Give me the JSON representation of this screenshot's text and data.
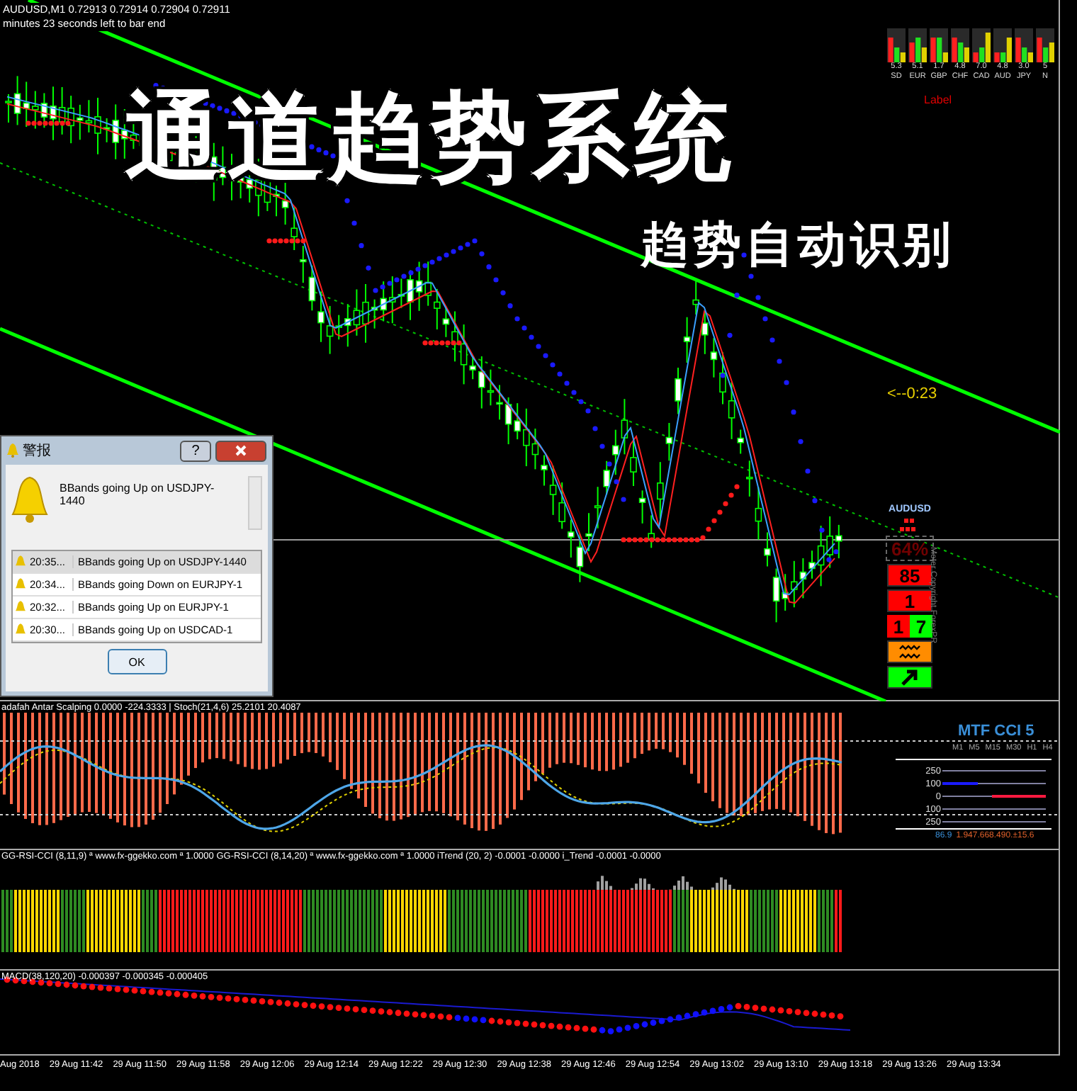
{
  "chart": {
    "symbol_line": "AUDUSD,M1  0.72913 0.72914 0.72904 0.72911",
    "timer_line": "minutes 23 seconds left to bar end",
    "title": "通道趋势系统",
    "subtitle": "趋势自动识别",
    "countdown": "<--0:23"
  },
  "strength_meter": {
    "label": "Label",
    "currencies": [
      {
        "value": "5.3",
        "code": "SD"
      },
      {
        "value": "5.1",
        "code": "EUR"
      },
      {
        "value": "1.7",
        "code": "GBP"
      },
      {
        "value": "4.8",
        "code": "CHF"
      },
      {
        "value": "7.0",
        "code": "CAD"
      },
      {
        "value": "4.8",
        "code": "AUD"
      },
      {
        "value": "3.0",
        "code": "JPY"
      },
      {
        "value": "5",
        "code": "N"
      }
    ]
  },
  "signal_panel": {
    "symbol": "AUDUSD",
    "percent": "64%",
    "copyright": "Meter Copyright ForexPR",
    "cells": [
      {
        "kind": "text",
        "text": "85",
        "color": "#ff0000"
      },
      {
        "kind": "text",
        "text": "1",
        "color": "#ff0000"
      },
      {
        "kind": "pair",
        "parts": [
          {
            "text": "1",
            "color": "#ff0000"
          },
          {
            "text": "7",
            "color": "#00ff00"
          }
        ]
      },
      {
        "kind": "wave",
        "color": "#ff8c00"
      },
      {
        "kind": "arrow",
        "color": "#00ff00"
      }
    ]
  },
  "alert_dialog": {
    "title": "警报",
    "help": "?",
    "message": "BBands going Up on USDJPY-1440",
    "ok": "OK",
    "rows": [
      {
        "time": "20:35...",
        "text": "BBands going Up on USDJPY-1440",
        "selected": true
      },
      {
        "time": "20:34...",
        "text": "BBands going Down on EURJPY-1",
        "selected": false
      },
      {
        "time": "20:32...",
        "text": "BBands going Up on EURJPY-1",
        "selected": false
      },
      {
        "time": "20:30...",
        "text": "BBands going Up on USDCAD-1",
        "selected": false
      }
    ]
  },
  "stoch_panel": {
    "legend": "adafah Antar Scalping 0.0000 -224.3333 | Stoch(21,4,6) 25.2101 20.4087",
    "mtf_title": "MTF CCI 5",
    "timeframes": [
      "M1",
      "M5",
      "M15",
      "M30",
      "H1",
      "H4"
    ],
    "levels": [
      "250",
      "100",
      "0",
      "100",
      "250"
    ],
    "readout": [
      {
        "text": "86.9",
        "color": "#3a8fd8"
      },
      {
        "text": "1.947.668.490.±15.6",
        "color": "#e0602a"
      }
    ]
  },
  "rsi_panel": {
    "legend": "GG-RSI-CCI (8,11,9) ª www.fx-ggekko.com ª 1.0000  GG-RSI-CCI (8,14,20) ª www.fx-ggekko.com ª 1.0000  iTrend (20, 2) -0.0001 -0.0000  i_Trend -0.0001 -0.0000"
  },
  "macd_panel": {
    "legend": "MACD(38,120,20) -0.000397 -0.000345 -0.000405"
  },
  "time_axis": [
    "Aug 2018",
    "29 Aug 11:42",
    "29 Aug 11:50",
    "29 Aug 11:58",
    "29 Aug 12:06",
    "29 Aug 12:14",
    "29 Aug 12:22",
    "29 Aug 12:30",
    "29 Aug 12:38",
    "29 Aug 12:46",
    "29 Aug 12:54",
    "29 Aug 13:02",
    "29 Aug 13:10",
    "29 Aug 13:18",
    "29 Aug 13:26",
    "29 Aug 13:34"
  ]
}
